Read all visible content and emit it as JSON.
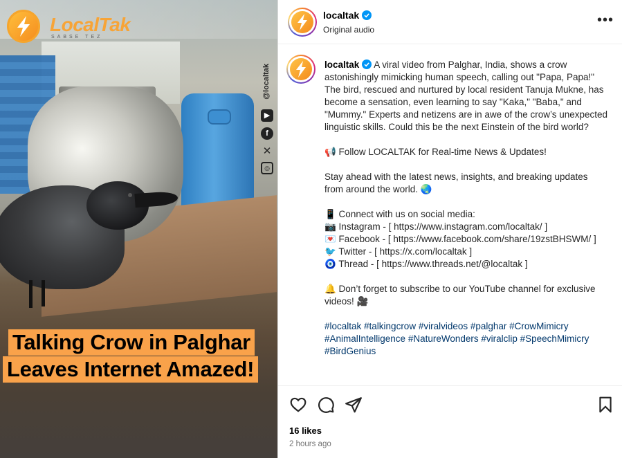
{
  "media": {
    "brand_name": "LocalTak",
    "brand_tagline": "SABSE TEZ",
    "side_handle": "@localtak",
    "headline_lines": [
      "Talking Crow in Palghar",
      "Leaves Internet Amazed!"
    ]
  },
  "post": {
    "username": "localtak",
    "audio_label": "Original audio",
    "more_icon": "more-icon"
  },
  "caption": {
    "username": "localtak",
    "paragraph_1": "A viral video from Palghar, India, shows a crow astonishingly mimicking human speech, calling out \"Papa, Papa!\" The bird, rescued and nurtured by local resident Tanuja Mukne, has become a sensation, even learning to say \"Kaka,\" \"Baba,\" and \"Mummy.\" Experts and netizens are in awe of the crow’s unexpected linguistic skills. Could this be the next Einstein of the bird world?",
    "follow_line": "📢 Follow LOCALTAK for Real-time News & Updates!",
    "stay_line": "Stay ahead with the latest news, insights, and breaking updates from around the world. 🌏",
    "connect_line": "📱 Connect with us on social media:",
    "instagram_line": "📷 Instagram - [ https://www.instagram.com/localtak/ ]",
    "facebook_line": "💌 Facebook - [ https://www.facebook.com/share/19zstBHSWM/ ]",
    "twitter_line": "🐦 Twitter - [ https://x.com/localtak ]",
    "thread_line": "🧿 Thread - [ https://www.threads.net/@localtak ]",
    "youtube_line": "🔔 Don’t forget to subscribe to our YouTube channel for exclusive videos! 🎥",
    "hashtags": "#localtak #talkingcrow #viralvideos #palghar #CrowMimicry #AnimalIntelligence #NatureWonders #viralclip #SpeechMimicry #BirdGenius"
  },
  "actions": {
    "likes": "16 likes",
    "timestamp": "2 hours ago"
  },
  "colors": {
    "brand_orange": "#f7a437",
    "headline_bg": "#f9a24a",
    "hashtag": "#00376b",
    "verified_blue": "#0095f6"
  }
}
